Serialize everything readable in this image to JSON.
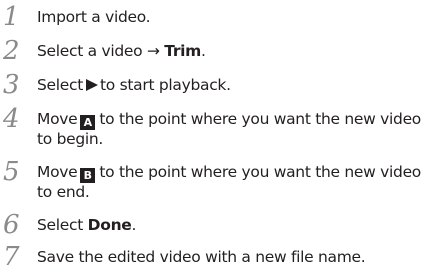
{
  "steps": [
    {
      "number": "1",
      "text": "Import a video."
    },
    {
      "number": "2",
      "text_before": "Select a video → ",
      "bold": "Trim",
      "text_after": "."
    },
    {
      "number": "3",
      "text_before": "Select",
      "icon": "play-triangle-icon",
      "text_after": "to start playback."
    },
    {
      "number": "4",
      "text_before": "Move",
      "handle_label": "A",
      "line1_after": "to the point where you want the new video",
      "line2": "to begin."
    },
    {
      "number": "5",
      "text_before": "Move",
      "handle_label": "B",
      "line1_after": "to the point where you want the new video",
      "line2": "to end."
    },
    {
      "number": "6",
      "text_before": "Select ",
      "bold": "Done",
      "text_after": "."
    },
    {
      "number": "7",
      "text": "Save the edited video with a new file name."
    }
  ],
  "colors": {
    "step_number": "#8a8a8a",
    "text": "#231f20",
    "icon_background": "#231f20",
    "icon_foreground": "#ffffff"
  }
}
